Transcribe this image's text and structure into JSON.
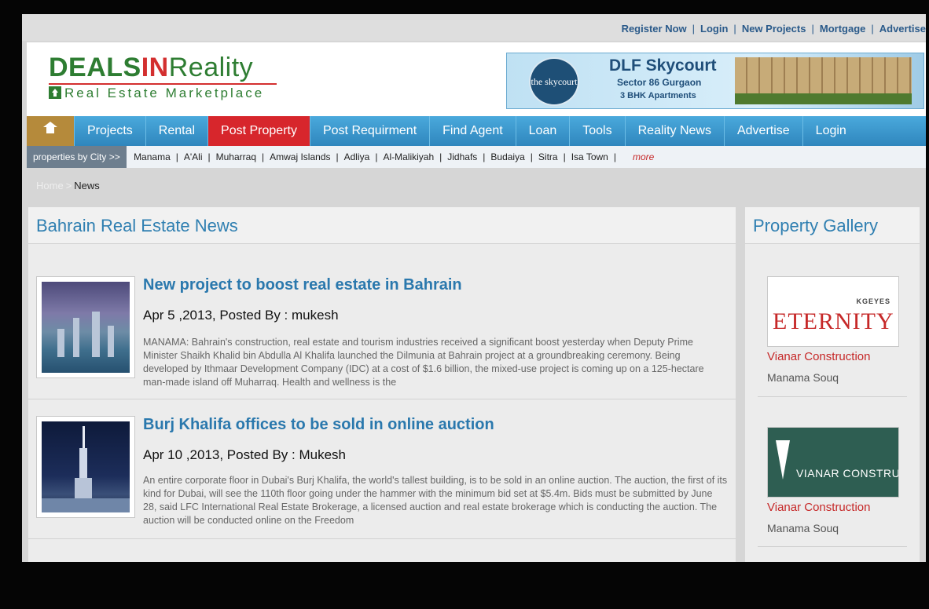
{
  "top_links": [
    "Register Now",
    "Login",
    "New Projects",
    "Mortgage",
    "Advertise"
  ],
  "logo": {
    "part1": "DEALS",
    "part2": "IN",
    "part3": "Reality",
    "tagline": "Real Estate Marketplace"
  },
  "banner": {
    "badge": "the skycourt",
    "title": "DLF Skycourt",
    "sub1": "Sector 86 Gurgaon",
    "sub2": "3 BHK Apartments"
  },
  "nav": {
    "items": [
      {
        "label": "Projects"
      },
      {
        "label": "Rental"
      },
      {
        "label": "Post Property",
        "active": true
      },
      {
        "label": "Post Requirment"
      },
      {
        "label": "Find Agent"
      },
      {
        "label": "Loan"
      },
      {
        "label": "Tools"
      },
      {
        "label": "Reality News"
      },
      {
        "label": "Advertise"
      },
      {
        "label": "Login"
      }
    ]
  },
  "city_bar": {
    "label": "properties by City >>",
    "cities": [
      "Manama",
      "A'Ali",
      "Muharraq",
      "Amwaj Islands",
      "Adliya",
      "Al-Malikiyah",
      "Jidhafs",
      "Budaiya",
      "Sitra",
      "Isa Town"
    ],
    "more": "more"
  },
  "breadcrumb": {
    "home": "Home",
    "sep": ">",
    "current": "News"
  },
  "main": {
    "heading": "Bahrain Real Estate News",
    "articles": [
      {
        "title": "New project to boost real estate in Bahrain",
        "meta": "Apr 5 ,2013, Posted By : mukesh",
        "body": "MANAMA: Bahrain's construction, real estate and tourism industries received a significant boost yesterday when Deputy Prime Minister Shaikh Khalid bin Abdulla Al Khalifa launched the Dilmunia at Bahrain project at a groundbreaking ceremony. Being developed by Ithmaar Development Company (IDC) at a cost of $1.6 billion, the mixed-use project is coming up on a 125-hectare man-made island off Muharraq. Health and wellness is the"
      },
      {
        "title": "Burj Khalifa offices to be sold in online auction",
        "meta": "Apr 10 ,2013, Posted By : Mukesh",
        "body": "An entire corporate floor in Dubai's Burj Khalifa, the world's tallest building, is to be sold in an online auction. The auction, the first of its kind for Dubai, will see the 110th floor going under the hammer with the minimum bid set at $5.4m. Bids must be submitted by June 28, said LFC International Real Estate Brokerage, a licensed auction and real estate brokerage which is conducting the auction. The auction will be conducted online on the Freedom"
      }
    ]
  },
  "gallery": {
    "heading": "Property Gallery",
    "items": [
      {
        "logo_small": "KGEYES",
        "logo_text": "ETERNITY",
        "name": "Vianar Construction",
        "location": "Manama Souq"
      },
      {
        "logo_text": "VIANAR CONSTRUCTIONS",
        "name": "Vianar Construction",
        "location": "Manama Souq"
      }
    ]
  }
}
